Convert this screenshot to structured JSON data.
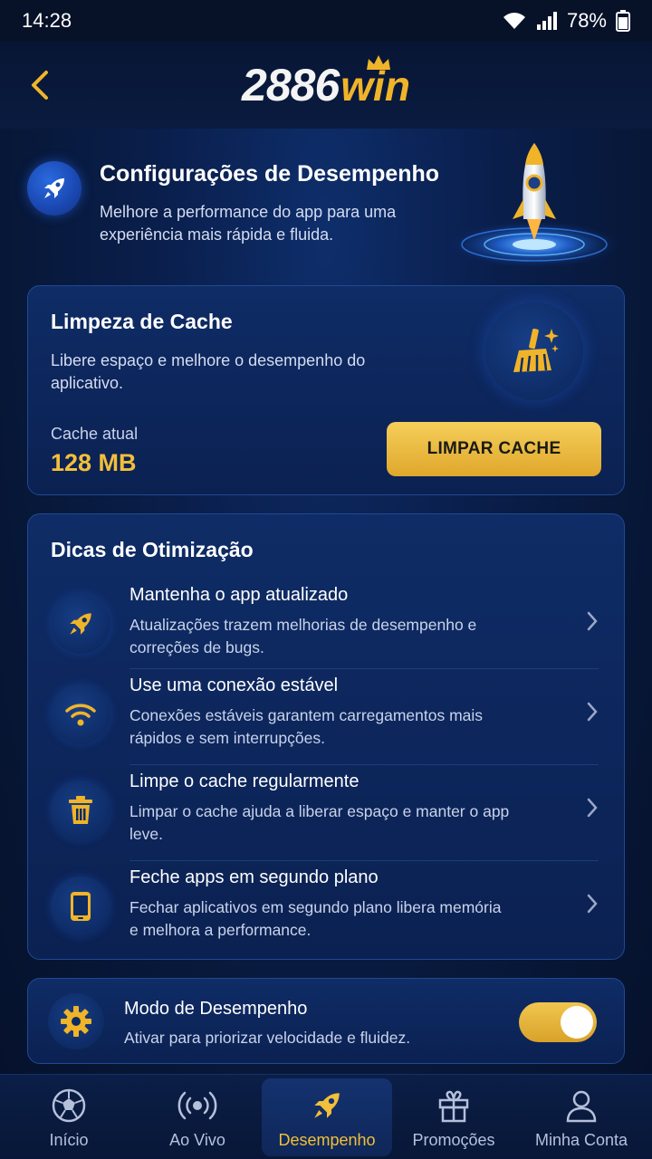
{
  "status_bar": {
    "time": "14:28",
    "battery": "78%"
  },
  "header": {
    "logo_number": "2886",
    "logo_word": "win"
  },
  "hero": {
    "title": "Configurações de Desempenho",
    "description": "Melhore a performance do app para uma experiência mais rápida e fluida."
  },
  "cache": {
    "title": "Limpeza de Cache",
    "description": "Libere espaço e melhore o desempenho do aplicativo.",
    "current_label": "Cache atual",
    "current_value": "128 MB",
    "button_label": "LIMPAR CACHE"
  },
  "tips": {
    "title": "Dicas de Otimização",
    "items": [
      {
        "icon": "rocket-icon",
        "title": "Mantenha o app atualizado",
        "description": "Atualizações trazem melhorias de desempenho e correções de bugs."
      },
      {
        "icon": "wifi-icon",
        "title": "Use uma conexão estável",
        "description": "Conexões estáveis garantem carregamentos mais rápidos e sem interrupções."
      },
      {
        "icon": "trash-icon",
        "title": "Limpe o cache regularmente",
        "description": "Limpar o cache ajuda a liberar espaço e manter o app leve."
      },
      {
        "icon": "phone-icon",
        "title": "Feche apps em segundo plano",
        "description": "Fechar aplicativos em segundo plano libera memória e melhora a performance."
      }
    ]
  },
  "performance_mode": {
    "title": "Modo de Desempenho",
    "description": "Ativar para priorizar velocidade e fluidez.",
    "enabled": true
  },
  "bottom_nav": {
    "items": [
      {
        "icon": "soccer-ball-icon",
        "label": "Início"
      },
      {
        "icon": "live-broadcast-icon",
        "label": "Ao Vivo"
      },
      {
        "icon": "rocket-icon",
        "label": "Desempenho",
        "active": true
      },
      {
        "icon": "gift-icon",
        "label": "Promoções"
      },
      {
        "icon": "user-icon",
        "label": "Minha Conta"
      }
    ]
  },
  "colors": {
    "accent_gold": "#f2bf3a",
    "background": "#0a1f4d",
    "card": "#0f2c66",
    "text_secondary": "#c9d3ea"
  }
}
